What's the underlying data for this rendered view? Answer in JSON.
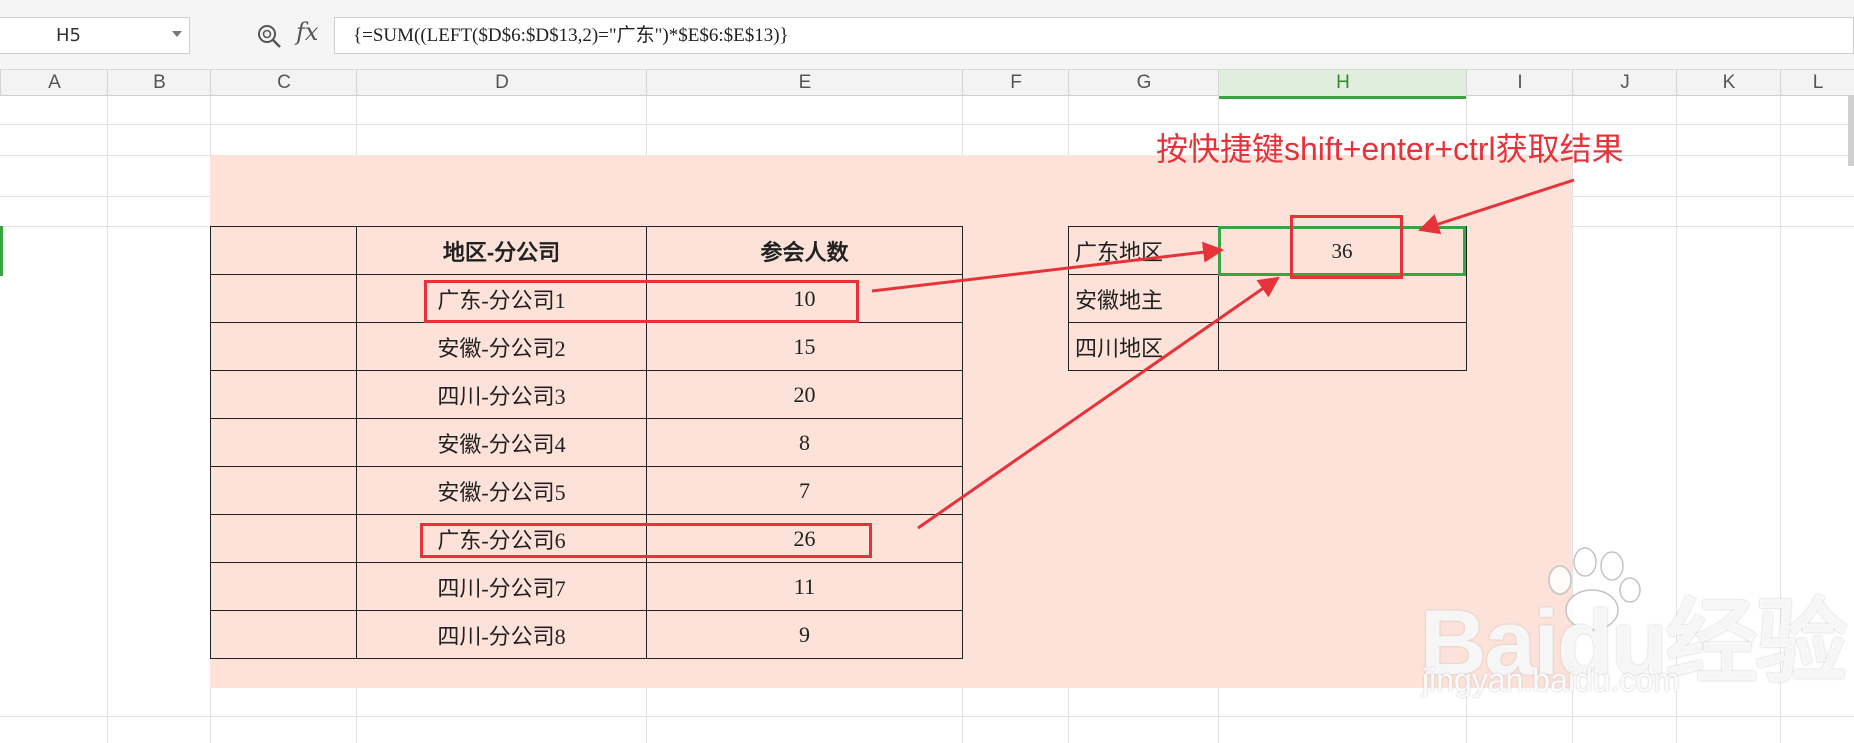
{
  "formula_bar": {
    "name_box": "H5",
    "fx_label": "fx",
    "formula": "{=SUM((LEFT($D$6:$D$13,2)=\"广东\")*$E$6:$E$13)}"
  },
  "columns": [
    "A",
    "B",
    "C",
    "D",
    "E",
    "F",
    "G",
    "H",
    "I",
    "J",
    "K",
    "L"
  ],
  "active_column": "H",
  "left_table": {
    "headers": [
      "地区-分公司",
      "参会人数"
    ],
    "rows": [
      {
        "company": "广东-分公司1",
        "count": "10"
      },
      {
        "company": "安徽-分公司2",
        "count": "15"
      },
      {
        "company": "四川-分公司3",
        "count": "20"
      },
      {
        "company": "安徽-分公司4",
        "count": "8"
      },
      {
        "company": "安徽-分公司5",
        "count": "7"
      },
      {
        "company": "广东-分公司6",
        "count": "26"
      },
      {
        "company": "四川-分公司7",
        "count": "11"
      },
      {
        "company": "四川-分公司8",
        "count": "9"
      }
    ]
  },
  "right_table": {
    "rows": [
      {
        "region": "广东地区",
        "value": "36"
      },
      {
        "region": "安徽地主",
        "value": ""
      },
      {
        "region": "四川地区",
        "value": ""
      }
    ]
  },
  "annotation": "按快捷键shift+enter+ctrl获取结果",
  "watermark": {
    "main": "Baidu经验",
    "sub": "jingyan.baidu.com"
  },
  "colors": {
    "highlight": "#fce2d8",
    "annotation_red": "#e8323a",
    "selection_green": "#3aa441"
  }
}
